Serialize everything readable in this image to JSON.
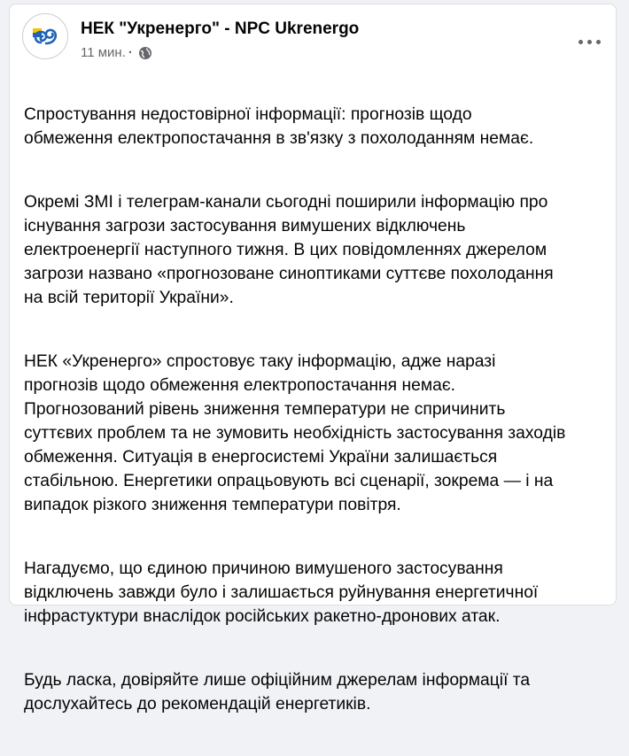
{
  "post": {
    "author": "НЕК \"Укренерго\" - NPC Ukrenergo",
    "time": "11 мин.",
    "separator": "·",
    "audience_icon": "globe-icon",
    "menu_icon": "more-options-icon",
    "paragraphs": [
      "Спростування недостовірної інформації: прогнозів щодо\nобмеження електропостачання в зв'язку з похолоданням немає.",
      "Окремі ЗМІ і телеграм-канали сьогодні поширили інформацію про\nіснування загрози застосування вимушених відключень\nелектроенергії наступного тижня. В цих повідомленнях джерелом\nзагрози названо «прогнозоване синоптиками суттєве похолодання\nна всій території України».",
      "НЕК «Укренерго» спростовує таку інформацію, адже наразі\nпрогнозів щодо обмеження електропостачання немає.\nПрогнозований рівень зниження температури не спричинить\nсуттєвих проблем та не зумовить необхідність застосування заходів\nобмеження. Ситуація в енергосистемі України залишається\nстабільною. Енергетики опрацьовують всі сценарії, зокрема — і на\nвипадок різкого зниження температури повітря.",
      "Нагадуємо, що єдиною причиною вимушеного застосування\nвідключень завжди було і залишається руйнування енергетичної\nінфрастуктури внаслідок російських ракетно-дронових атак.",
      "Будь ласка, довіряйте лише офіційним джерелам інформації та\nдослухайтесь до рекомендацій енергетиків."
    ]
  },
  "colors": {
    "background": "#f0f2f5",
    "text": "#050505",
    "secondary_text": "#65676b",
    "logo_blue": "#1e63b4",
    "logo_yellow": "#f5c400"
  }
}
